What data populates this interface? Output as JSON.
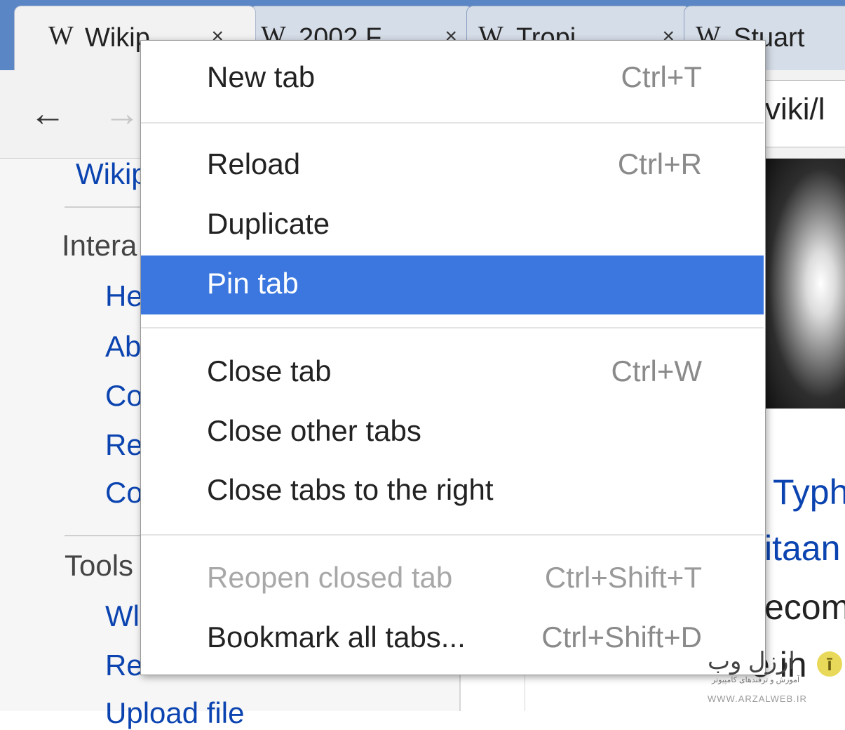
{
  "tabs": [
    {
      "favicon": "W",
      "title": "Wikip",
      "close": "×",
      "active": true
    },
    {
      "favicon": "W",
      "title": "2002 F",
      "close": "×",
      "active": false
    },
    {
      "favicon": "W",
      "title": "Tropi",
      "close": "×",
      "active": false
    },
    {
      "favicon": "W",
      "title": "Stuart",
      "close": "",
      "active": false
    }
  ],
  "toolbar": {
    "back_icon": "←",
    "forward_icon": "→",
    "omnibox_text": "viki/l"
  },
  "sidebar": {
    "top_link": "Wikip",
    "interaction_heading": "Intera",
    "interaction_links": [
      "He",
      "Ab",
      "Co",
      "Re",
      "Co"
    ],
    "tools_heading": "Tools",
    "tools_links": [
      "Wl",
      "Re"
    ],
    "upload_link": "Upload file"
  },
  "article": {
    "lines": [
      "Typh",
      "itaan",
      "ecom",
      "e in"
    ]
  },
  "context_menu": {
    "new_tab": {
      "label": "New tab",
      "shortcut": "Ctrl+T"
    },
    "reload": {
      "label": "Reload",
      "shortcut": "Ctrl+R"
    },
    "duplicate": {
      "label": "Duplicate",
      "shortcut": ""
    },
    "pin_tab": {
      "label": "Pin tab",
      "shortcut": ""
    },
    "close_tab": {
      "label": "Close tab",
      "shortcut": "Ctrl+W"
    },
    "close_other_tabs": {
      "label": "Close other tabs",
      "shortcut": ""
    },
    "close_tabs_right": {
      "label": "Close tabs to the right",
      "shortcut": ""
    },
    "reopen_closed_tab": {
      "label": "Reopen closed tab",
      "shortcut": "Ctrl+Shift+T"
    },
    "bookmark_all_tabs": {
      "label": "Bookmark all tabs...",
      "shortcut": "Ctrl+Shift+D"
    }
  },
  "watermark": {
    "brand": "ارزل وب",
    "subtitle": "آموزش و ترفندهای کامپیوتر",
    "url": "WWW.ARZALWEB.IR",
    "icon": "ī"
  },
  "colors": {
    "tabstrip": "#5b86c5",
    "highlight": "#3b77de",
    "link": "#0b44b0"
  }
}
